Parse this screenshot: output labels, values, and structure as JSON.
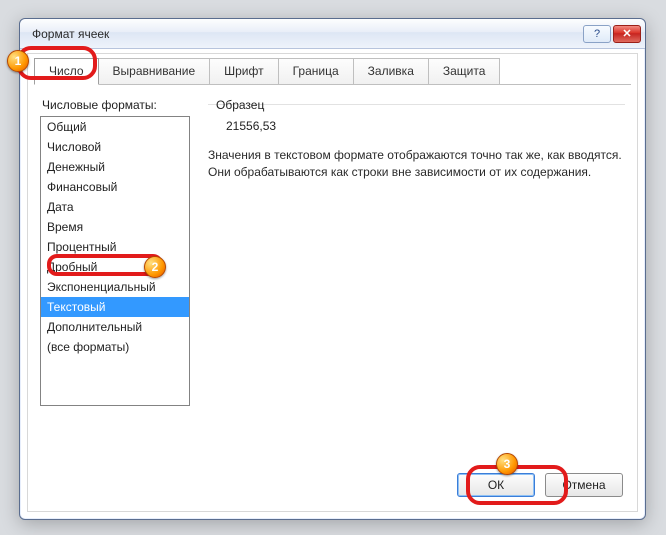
{
  "window": {
    "title": "Формат ячеек",
    "help_label": "?",
    "close_label": "✕"
  },
  "tabs": [
    {
      "label": "Число",
      "active": true
    },
    {
      "label": "Выравнивание"
    },
    {
      "label": "Шрифт"
    },
    {
      "label": "Граница"
    },
    {
      "label": "Заливка"
    },
    {
      "label": "Защита"
    }
  ],
  "list_label": "Числовые форматы:",
  "formats": [
    "Общий",
    "Числовой",
    "Денежный",
    "Финансовый",
    "Дата",
    "Время",
    "Процентный",
    "Дробный",
    "Экспоненциальный",
    "Текстовый",
    "Дополнительный",
    "(все форматы)"
  ],
  "selected_format_index": 9,
  "sample": {
    "label": "Образец",
    "value": "21556,53"
  },
  "description": "Значения в текстовом формате отображаются точно так же, как вводятся. Они обрабатываются как строки вне зависимости от их содержания.",
  "buttons": {
    "ok": "ОК",
    "cancel": "Отмена"
  },
  "callouts": {
    "b1": "1",
    "b2": "2",
    "b3": "3"
  }
}
